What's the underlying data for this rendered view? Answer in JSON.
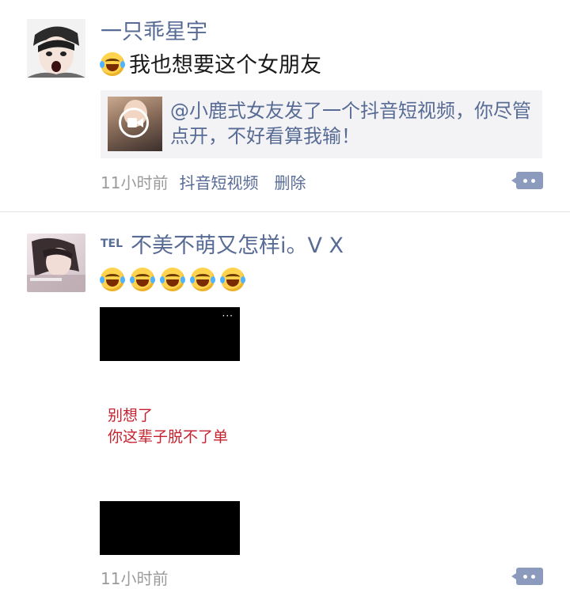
{
  "posts": [
    {
      "author": "一只乖星宇",
      "text": "我也想要这个女朋友",
      "share": {
        "text": "@小鹿式女友发了一个抖音短视频，你尽管点开，不好看算我输！"
      },
      "time": "11小时前",
      "source": "抖音短视频",
      "delete_label": "删除",
      "icons": {
        "emoji": "laughing-tears-emoji",
        "play": "video-play-icon",
        "comment": "comment-more-icon"
      }
    },
    {
      "tag": "TEL",
      "author": "不美不萌又怎样i。V X",
      "emoji_count": 5,
      "image": {
        "more": "···",
        "caption_line1": "别想了",
        "caption_line2": "你这辈子脱不了单"
      },
      "time": "11小时前"
    }
  ],
  "colors": {
    "link": "#576b95",
    "meta": "#9b9b9b",
    "caption": "#c4222e",
    "card_bg": "#f3f3f5"
  }
}
